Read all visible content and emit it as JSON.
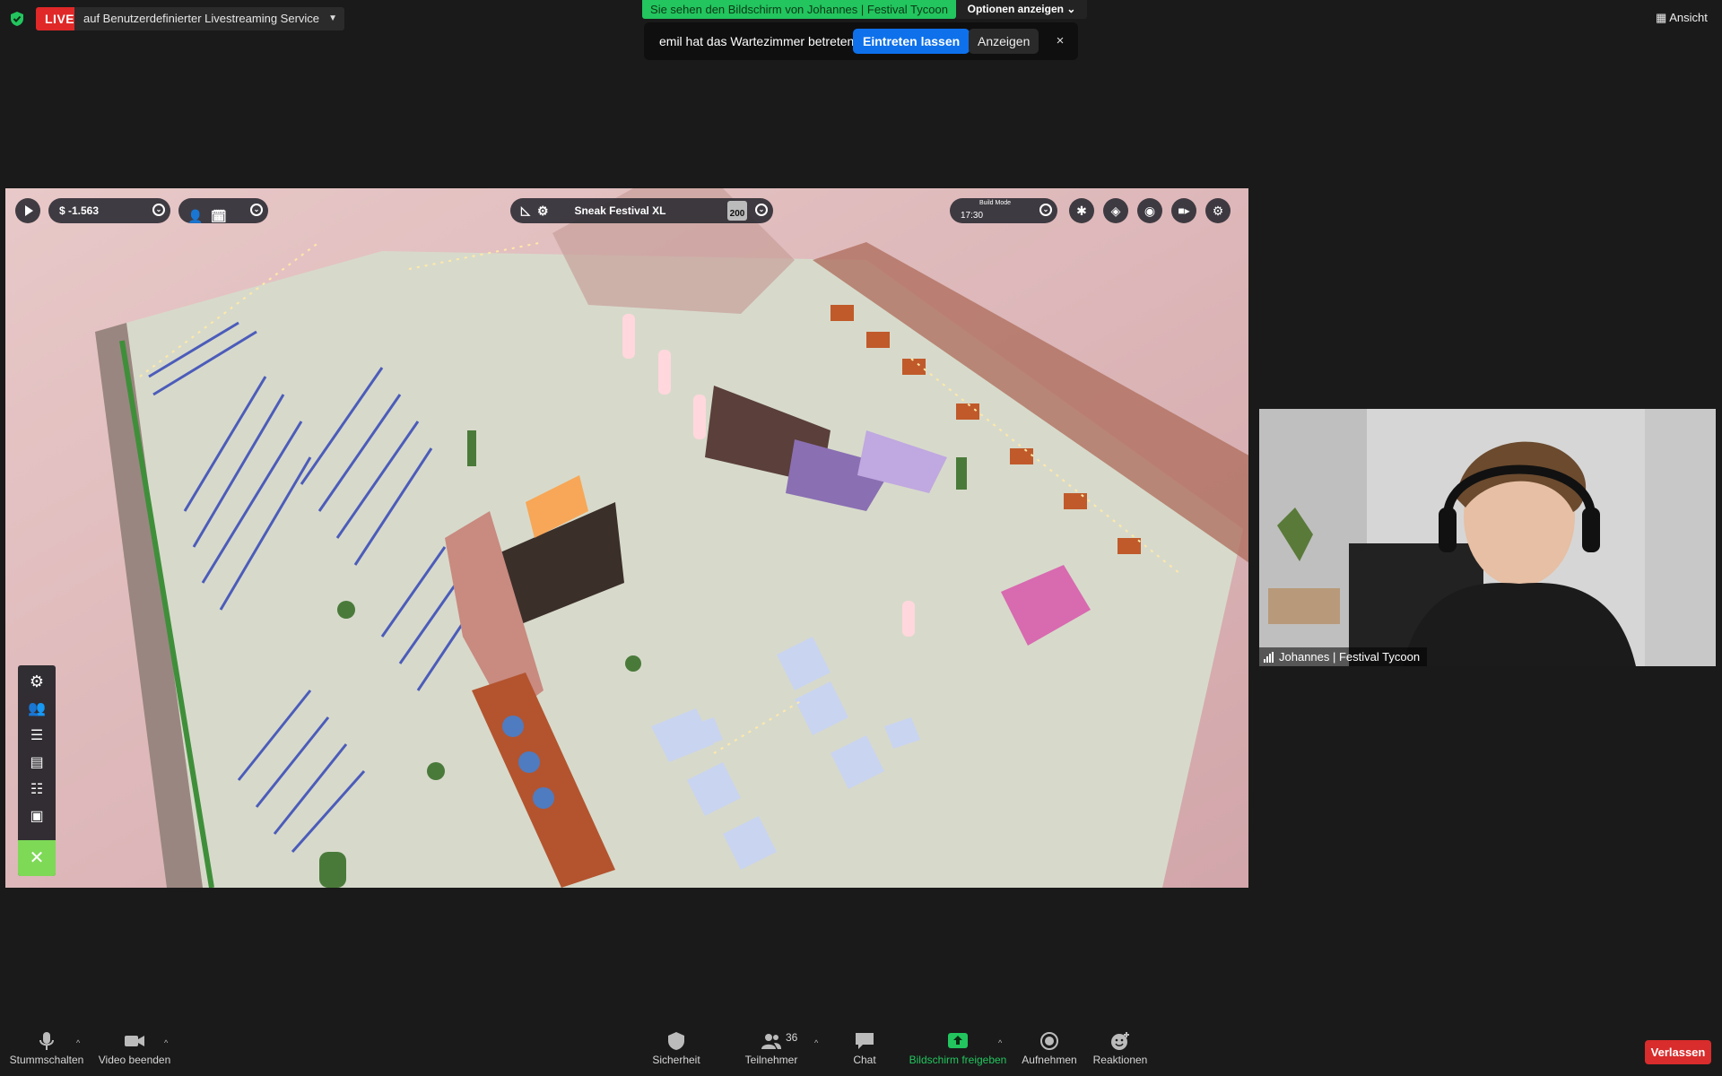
{
  "live": {
    "badge": "LIVE",
    "service": "auf Benutzerdefinierter Livestreaming Service"
  },
  "share": {
    "banner": "Sie sehen den Bildschirm von Johannes | Festival Tycoon",
    "options": "Optionen anzeigen"
  },
  "notification": {
    "text": "emil hat das Wartezimmer betreten",
    "admit": "Eintreten lassen",
    "view": "Anzeigen",
    "close": "×"
  },
  "view_menu": "Ansicht",
  "game": {
    "money": "$ -1.563",
    "festival_name": "Sneak Festival XL",
    "capacity_badge": "200",
    "mode_label": "Build Mode",
    "time": "17:30"
  },
  "participant": {
    "name": "Johannes | Festival Tycoon"
  },
  "toolbar": {
    "mute": "Stummschalten",
    "video": "Video beenden",
    "security": "Sicherheit",
    "participants": "Teilnehmer",
    "participants_count": "36",
    "chat": "Chat",
    "share": "Bildschirm freigeben",
    "record": "Aufnehmen",
    "reactions": "Reaktionen",
    "leave": "Verlassen"
  },
  "colors": {
    "live": "#e02828",
    "share_banner": "#22c55e",
    "admit": "#0e71eb",
    "leave": "#d92c2c",
    "share_icon": "#22c55e",
    "build_tool": "#7ed957"
  }
}
